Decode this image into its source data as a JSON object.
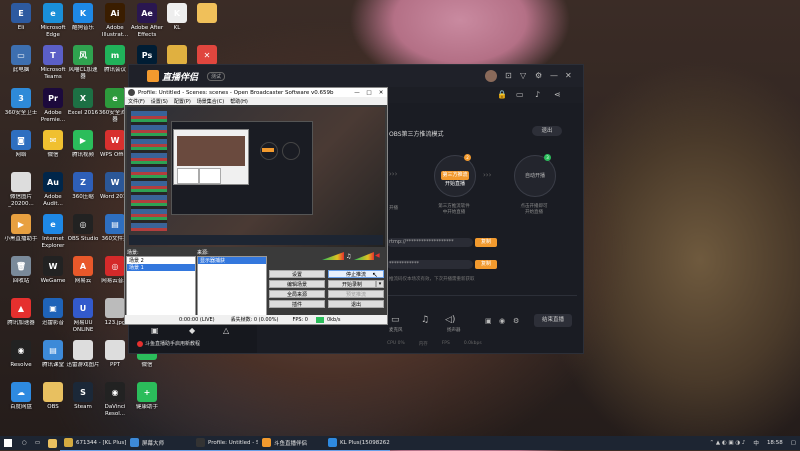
{
  "desktop": {
    "icons": [
      {
        "label": "Eli",
        "color": "#2d5aa0",
        "glyph": "E"
      },
      {
        "label": "Microsoft Edge",
        "color": "#1a8fd8",
        "glyph": "e"
      },
      {
        "label": "酷狗音乐",
        "color": "#1e88e5",
        "glyph": "K"
      },
      {
        "label": "Adobe Illustrat...",
        "color": "#3a1d00",
        "glyph": "Ai"
      },
      {
        "label": "Adobe After Effects 2019",
        "color": "#2a1750",
        "glyph": "Ae"
      },
      {
        "label": "KL",
        "color": "#eeeeee",
        "glyph": "K"
      },
      {
        "label": "",
        "color": "#f0c05a",
        "glyph": ""
      },
      {
        "label": "此电脑",
        "color": "#3d6fb0",
        "glyph": "▭"
      },
      {
        "label": "Microsoft Teams",
        "color": "#5b5fc7",
        "glyph": "T"
      },
      {
        "label": "风喵CL加速器",
        "color": "#2fa24f",
        "glyph": "风"
      },
      {
        "label": "腾讯会议",
        "color": "#20b25a",
        "glyph": "m"
      },
      {
        "label": "Ps",
        "color": "#001d34",
        "glyph": "Ps"
      },
      {
        "label": "",
        "color": "#e0b040",
        "glyph": ""
      },
      {
        "label": "",
        "color": "#e0463e",
        "glyph": "✕"
      },
      {
        "label": "360安全卫士",
        "color": "#2e8ad8",
        "glyph": "3"
      },
      {
        "label": "Adobe Premie...",
        "color": "#1c0a3c",
        "glyph": "Pr"
      },
      {
        "label": "Excel 2016",
        "color": "#1d7044",
        "glyph": "X"
      },
      {
        "label": "360安全浏览器",
        "color": "#2d9a3c",
        "glyph": "e"
      },
      {
        "label": "网络",
        "color": "#2e6fc0",
        "glyph": "◙"
      },
      {
        "label": "微信",
        "color": "#f0c030",
        "glyph": "✉"
      },
      {
        "label": "腾讯视频",
        "color": "#2bbd5b",
        "glyph": "▶"
      },
      {
        "label": "WPS Office",
        "color": "#d8302e",
        "glyph": "W"
      },
      {
        "label": "微信图片_20200...",
        "color": "#dddddd",
        "glyph": ""
      },
      {
        "label": "Adobe Audit...",
        "color": "#00264a",
        "glyph": "Au"
      },
      {
        "label": "360压缩",
        "color": "#2e5fb8",
        "glyph": "Z"
      },
      {
        "label": "Word 2016",
        "color": "#2b5797",
        "glyph": "W"
      },
      {
        "label": "小黑直播助手",
        "color": "#e8a040",
        "glyph": "▶"
      },
      {
        "label": "Internet Explorer",
        "color": "#1e88e5",
        "glyph": "e"
      },
      {
        "label": "OBS Studio",
        "color": "#222222",
        "glyph": "◎"
      },
      {
        "label": "360文件夹",
        "color": "#2e6fc0",
        "glyph": "▤"
      },
      {
        "label": "回收站",
        "color": "#7a8a9a",
        "glyph": "🗑"
      },
      {
        "label": "WeGame",
        "color": "#222222",
        "glyph": "W"
      },
      {
        "label": "网易云",
        "color": "#e8582a",
        "glyph": "A"
      },
      {
        "label": "网易云音乐",
        "color": "#d42a2a",
        "glyph": "◎"
      },
      {
        "label": "腾讯加速器",
        "color": "#e5302e",
        "glyph": "▲"
      },
      {
        "label": "迅雷影音",
        "color": "#1f63b8",
        "glyph": "▣"
      },
      {
        "label": "网易UU ONLINE",
        "color": "#335acc",
        "glyph": "U"
      },
      {
        "label": "123.jpg",
        "color": "#bbbbbb",
        "glyph": ""
      },
      {
        "label": "QQ",
        "color": "#1a88e0",
        "glyph": "Q"
      },
      {
        "label": "Resolve",
        "color": "#222222",
        "glyph": "◉"
      },
      {
        "label": "腾讯课堂",
        "color": "#3d8ad8",
        "glyph": "▤"
      },
      {
        "label": "迅雷游戏图片",
        "color": "#dddddd",
        "glyph": ""
      },
      {
        "label": "PPT",
        "color": "#dddddd",
        "glyph": ""
      },
      {
        "label": "微信",
        "color": "#2bbd5b",
        "glyph": "✉"
      },
      {
        "label": "百度网盘",
        "color": "#2e8ae0",
        "glyph": "☁"
      },
      {
        "label": "OBS",
        "color": "#e8c060",
        "glyph": ""
      },
      {
        "label": "Steam",
        "color": "#1b2838",
        "glyph": "S"
      },
      {
        "label": "DaVinci Resol...",
        "color": "#222222",
        "glyph": "◉"
      },
      {
        "label": "健康助手",
        "color": "#2bbd5b",
        "glyph": "+"
      }
    ]
  },
  "live_app": {
    "logo": "直播伴侣",
    "version": "测试",
    "mode_title": "OBS第三方推流模式",
    "exit_label": "退出",
    "steps": [
      {
        "num": "1",
        "text": "开始直播"
      },
      {
        "num": "2",
        "text": "第三方推流开始直播"
      },
      {
        "num": "3",
        "text": "自动开播"
      }
    ],
    "step1_caption": "开播",
    "step2_caption": "第三方推流软件\n中开始直播",
    "step3_caption": "点击开播即可\n开始直播",
    "server_masked": "rtmp://*******************",
    "key_masked": "************",
    "copy_label": "复制",
    "hint_text": "推流码仅本场次有效，下次开播需重新获取",
    "bottom_tools": [
      "连麦",
      "PK",
      "切换",
      "麦克风",
      "扬声器"
    ],
    "start_btn": "结束直播",
    "status_bar": [
      "CPU 0%",
      "内存",
      "FPS",
      "0.0kbps"
    ],
    "notice": "斗鱼直播助手启用新教程"
  },
  "obs": {
    "title": "Profile: Untitled - Scenes: scenes - Open Broadcaster Software v0.659b",
    "menu": [
      "文件(F)",
      "设置(S)",
      "配置(P)",
      "场景集合(C)",
      "帮助(H)"
    ],
    "scenes_label": "场景:",
    "sources_label": "来源:",
    "scenes": [
      "场景 2",
      "场景 1"
    ],
    "sources": [
      "显示器捕获"
    ],
    "buttons": {
      "settings": "设置",
      "stop_stream": "停止推流",
      "edit_scene": "编辑场景",
      "start_record": "开始录制",
      "global_sources": "全局来源",
      "preview_stream": "预览推流",
      "plugins": "插件",
      "exit": "退出"
    },
    "status": {
      "time": "0:00:00 (LIVE)",
      "dropped": "丢失帧数: 0 (0.00%)",
      "fps": "FPS: 0",
      "bitrate": "0kb/s"
    }
  },
  "taskbar": {
    "items": [
      {
        "label": "671344 - [KL Plus]",
        "color": "#d4aa40"
      },
      {
        "label": "屏幕大师",
        "color": "#3d8ad8"
      },
      {
        "label": "Profile: Untitled - Sc...",
        "color": "#333333"
      },
      {
        "label": "斗鱼直播伴侣",
        "color": "#f29a2e"
      },
      {
        "label": "KL Plus(15098262)",
        "color": "#2e8ae0"
      }
    ],
    "time": "18:58",
    "lang": "中"
  }
}
